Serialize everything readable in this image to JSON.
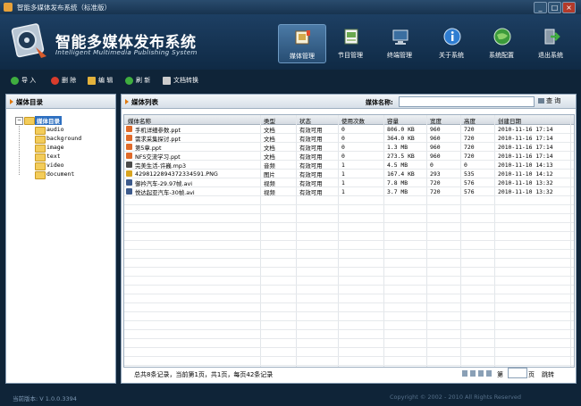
{
  "window": {
    "title": "智能多媒体发布系统（标准版）",
    "controls": [
      "_",
      "□",
      "×"
    ]
  },
  "brand": {
    "name_cn": "智能多媒体发布系统",
    "name_en": "Intelligent Multimedia Publishing System"
  },
  "nav": [
    {
      "label": "媒体管理",
      "icon": "media-icon",
      "active": true
    },
    {
      "label": "节目管理",
      "icon": "program-icon",
      "active": false
    },
    {
      "label": "终端管理",
      "icon": "terminal-icon",
      "active": false
    },
    {
      "label": "关于系统",
      "icon": "info-icon",
      "active": false
    },
    {
      "label": "系统配置",
      "icon": "globe-icon",
      "active": false
    },
    {
      "label": "退出系统",
      "icon": "exit-icon",
      "active": false
    }
  ],
  "toolbar": [
    {
      "label": "导 入",
      "icon": "import-icon",
      "color": "#3fae3f"
    },
    {
      "label": "删 除",
      "icon": "delete-icon",
      "color": "#d83c2c"
    },
    {
      "label": "编 辑",
      "icon": "edit-icon",
      "color": "#e3b23c"
    },
    {
      "label": "刷 新",
      "icon": "refresh-icon",
      "color": "#3fae3f"
    },
    {
      "label": "文档转换",
      "icon": "convert-icon",
      "color": "#cccccc"
    }
  ],
  "left_panel": {
    "title": "媒体目录",
    "root": "媒体目录",
    "folders": [
      "audio",
      "background",
      "image",
      "text",
      "video",
      "document"
    ]
  },
  "right_panel": {
    "title": "媒体列表",
    "search": {
      "label": "媒体名称:",
      "value": "",
      "button": "查 询"
    }
  },
  "table": {
    "columns": [
      "媒体名称",
      "类型",
      "状态",
      "使用次数",
      "容量",
      "宽度",
      "高度",
      "创建日期"
    ],
    "rows": [
      {
        "name": "手机详细参数.ppt",
        "type": "文档",
        "status": "有效可用",
        "uses": "0",
        "size": "806.0 KB",
        "width": "960",
        "height": "720",
        "date": "2010-11-16 17:14",
        "icon_color": "#e06a2a"
      },
      {
        "name": "需求采集探讨.ppt",
        "type": "文档",
        "status": "有效可用",
        "uses": "0",
        "size": "364.0 KB",
        "width": "960",
        "height": "720",
        "date": "2010-11-16 17:14",
        "icon_color": "#e06a2a"
      },
      {
        "name": "第5章.ppt",
        "type": "文档",
        "status": "有效可用",
        "uses": "0",
        "size": "1.3 MB",
        "width": "960",
        "height": "720",
        "date": "2010-11-16 17:14",
        "icon_color": "#e06a2a"
      },
      {
        "name": "NFS交流学习.ppt",
        "type": "文档",
        "status": "有效可用",
        "uses": "0",
        "size": "273.5 KB",
        "width": "960",
        "height": "720",
        "date": "2010-11-16 17:14",
        "icon_color": "#e06a2a"
      },
      {
        "name": "完美生活-许巍.mp3",
        "type": "音频",
        "status": "有效可用",
        "uses": "1",
        "size": "4.5 MB",
        "width": "0",
        "height": "0",
        "date": "2010-11-10 14:13",
        "icon_color": "#4a4a4a"
      },
      {
        "name": "4298122894372334591.PNG",
        "type": "图片",
        "status": "有效可用",
        "uses": "1",
        "size": "167.4 KB",
        "width": "293",
        "height": "535",
        "date": "2010-11-10 14:12",
        "icon_color": "#d9a520"
      },
      {
        "name": "御衿汽车-29.97帧.avi",
        "type": "视频",
        "status": "有效可用",
        "uses": "1",
        "size": "7.8 MB",
        "width": "720",
        "height": "576",
        "date": "2010-11-10 13:32",
        "icon_color": "#3c5a8c"
      },
      {
        "name": "悦达起亚汽车-30帧.avi",
        "type": "视频",
        "status": "有效可用",
        "uses": "1",
        "size": "3.7 MB",
        "width": "720",
        "height": "576",
        "date": "2010-11-10 13:32",
        "icon_color": "#3c5a8c"
      }
    ]
  },
  "pager": {
    "summary": "总共8条记录，当前第1页，共1页，每页42条记录",
    "page_label": "第",
    "page_value": "",
    "page_suffix": "页",
    "go": "跳转"
  },
  "status": {
    "version": "当前版本: V 1.0.0.3394",
    "copyright": "Copyright © 2002 - 2010          All Rights Reserved"
  }
}
